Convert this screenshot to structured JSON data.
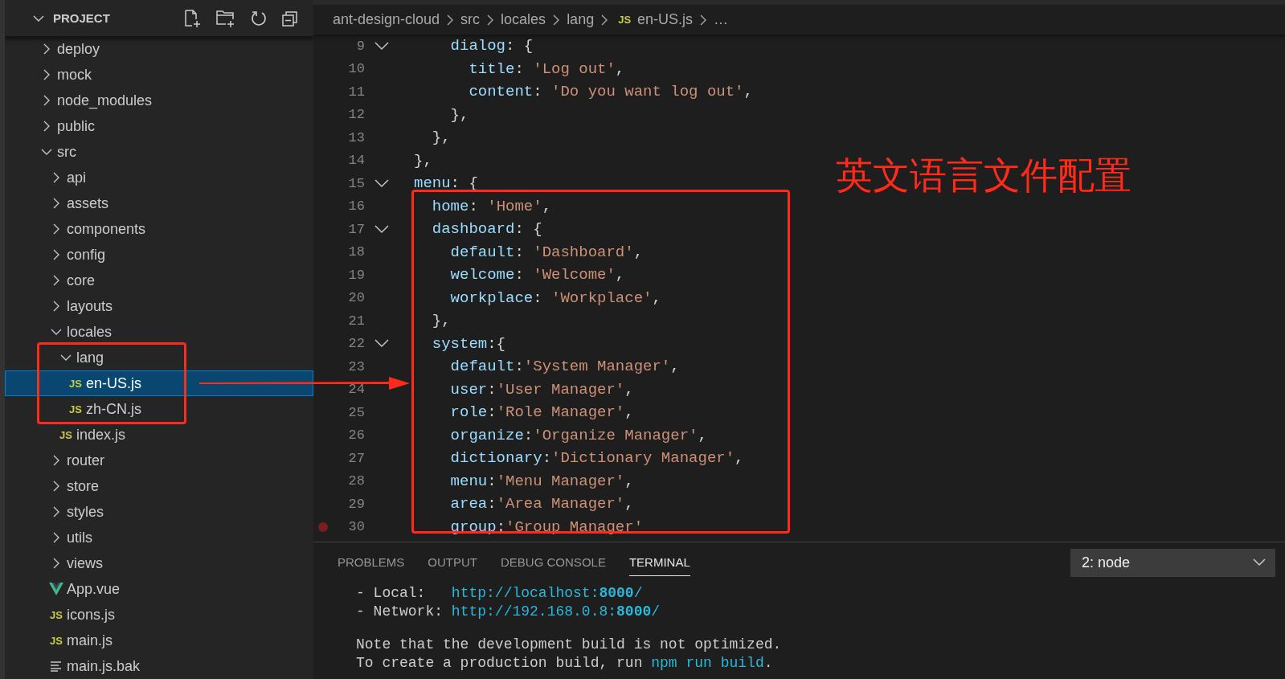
{
  "sidebar": {
    "title": "PROJECT",
    "expanded": true,
    "tree": [
      {
        "name": "deploy",
        "kind": "folder",
        "expanded": false,
        "selected": false
      },
      {
        "name": "mock",
        "kind": "folder",
        "expanded": false,
        "selected": false
      },
      {
        "name": "node_modules",
        "kind": "folder",
        "expanded": false,
        "selected": false
      },
      {
        "name": "public",
        "kind": "folder",
        "expanded": false,
        "selected": false
      },
      {
        "name": "src",
        "kind": "folder",
        "expanded": true,
        "selected": false,
        "children": [
          {
            "name": "api",
            "kind": "folder",
            "expanded": false,
            "selected": false
          },
          {
            "name": "assets",
            "kind": "folder",
            "expanded": false,
            "selected": false
          },
          {
            "name": "components",
            "kind": "folder",
            "expanded": false,
            "selected": false
          },
          {
            "name": "config",
            "kind": "folder",
            "expanded": false,
            "selected": false
          },
          {
            "name": "core",
            "kind": "folder",
            "expanded": false,
            "selected": false
          },
          {
            "name": "layouts",
            "kind": "folder",
            "expanded": false,
            "selected": false
          },
          {
            "name": "locales",
            "kind": "folder",
            "expanded": true,
            "selected": false,
            "children": [
              {
                "name": "lang",
                "kind": "folder",
                "expanded": true,
                "selected": false,
                "children": [
                  {
                    "name": "en-US.js",
                    "kind": "js",
                    "badge": "JS",
                    "selected": true
                  },
                  {
                    "name": "zh-CN.js",
                    "kind": "js",
                    "badge": "JS",
                    "selected": false
                  }
                ]
              },
              {
                "name": "index.js",
                "kind": "js",
                "badge": "JS",
                "selected": false
              }
            ]
          },
          {
            "name": "router",
            "kind": "folder",
            "expanded": false,
            "selected": false
          },
          {
            "name": "store",
            "kind": "folder",
            "expanded": false,
            "selected": false
          },
          {
            "name": "styles",
            "kind": "folder",
            "expanded": false,
            "selected": false
          },
          {
            "name": "utils",
            "kind": "folder",
            "expanded": false,
            "selected": false
          },
          {
            "name": "views",
            "kind": "folder",
            "expanded": false,
            "selected": false
          },
          {
            "name": "App.vue",
            "kind": "vue",
            "selected": false
          },
          {
            "name": "icons.js",
            "kind": "js",
            "badge": "JS",
            "selected": false
          },
          {
            "name": "main.js",
            "kind": "js",
            "badge": "JS",
            "selected": false
          },
          {
            "name": "main.js.bak",
            "kind": "text",
            "selected": false
          }
        ]
      }
    ]
  },
  "breadcrumb": [
    {
      "text": "ant-design-cloud"
    },
    {
      "text": "src"
    },
    {
      "text": "locales"
    },
    {
      "text": "lang"
    },
    {
      "text": "en-US.js",
      "badge": "JS"
    },
    {
      "text": "…"
    }
  ],
  "code": [
    {
      "number": "9",
      "fold": true,
      "tokens": [
        {
          "kind": "key",
          "text": "    dialog"
        },
        {
          "kind": "punct",
          "text": ": {"
        }
      ]
    },
    {
      "number": "10",
      "tokens": [
        {
          "kind": "key",
          "text": "      title"
        },
        {
          "kind": "punct",
          "text": ": "
        },
        {
          "kind": "string",
          "text": "'Log out'"
        },
        {
          "kind": "punct",
          "text": ","
        }
      ]
    },
    {
      "number": "11",
      "tokens": [
        {
          "kind": "key",
          "text": "      content"
        },
        {
          "kind": "punct",
          "text": ": "
        },
        {
          "kind": "string",
          "text": "'Do you want log out'"
        },
        {
          "kind": "punct",
          "text": ","
        }
      ]
    },
    {
      "number": "12",
      "tokens": [
        {
          "kind": "punct",
          "text": "    },"
        }
      ]
    },
    {
      "number": "13",
      "tokens": [
        {
          "kind": "punct",
          "text": "  },"
        }
      ]
    },
    {
      "number": "14",
      "tokens": [
        {
          "kind": "punct",
          "text": "},"
        }
      ]
    },
    {
      "number": "15",
      "fold": true,
      "tokens": [
        {
          "kind": "key",
          "text": "menu"
        },
        {
          "kind": "punct",
          "text": ": {"
        }
      ]
    },
    {
      "number": "16",
      "tokens": [
        {
          "kind": "key",
          "text": "  home"
        },
        {
          "kind": "punct",
          "text": ": "
        },
        {
          "kind": "string",
          "text": "'Home'"
        },
        {
          "kind": "punct",
          "text": ","
        }
      ]
    },
    {
      "number": "17",
      "fold": true,
      "tokens": [
        {
          "kind": "key",
          "text": "  dashboard"
        },
        {
          "kind": "punct",
          "text": ": {"
        }
      ]
    },
    {
      "number": "18",
      "tokens": [
        {
          "kind": "key",
          "text": "    default"
        },
        {
          "kind": "punct",
          "text": ": "
        },
        {
          "kind": "string",
          "text": "'Dashboard'"
        },
        {
          "kind": "punct",
          "text": ","
        }
      ]
    },
    {
      "number": "19",
      "tokens": [
        {
          "kind": "key",
          "text": "    welcome"
        },
        {
          "kind": "punct",
          "text": ": "
        },
        {
          "kind": "string",
          "text": "'Welcome'"
        },
        {
          "kind": "punct",
          "text": ","
        }
      ]
    },
    {
      "number": "20",
      "tokens": [
        {
          "kind": "key",
          "text": "    workplace"
        },
        {
          "kind": "punct",
          "text": ": "
        },
        {
          "kind": "string",
          "text": "'Workplace'"
        },
        {
          "kind": "punct",
          "text": ","
        }
      ]
    },
    {
      "number": "21",
      "tokens": [
        {
          "kind": "punct",
          "text": "  },"
        }
      ]
    },
    {
      "number": "22",
      "fold": true,
      "tokens": [
        {
          "kind": "key",
          "text": "  system"
        },
        {
          "kind": "punct",
          "text": ":{"
        }
      ]
    },
    {
      "number": "23",
      "tokens": [
        {
          "kind": "key",
          "text": "    default"
        },
        {
          "kind": "punct",
          "text": ":"
        },
        {
          "kind": "string",
          "text": "'System Manager'"
        },
        {
          "kind": "punct",
          "text": ","
        }
      ]
    },
    {
      "number": "24",
      "tokens": [
        {
          "kind": "key",
          "text": "    user"
        },
        {
          "kind": "punct",
          "text": ":"
        },
        {
          "kind": "string",
          "text": "'User Manager'"
        },
        {
          "kind": "punct",
          "text": ","
        }
      ]
    },
    {
      "number": "25",
      "tokens": [
        {
          "kind": "key",
          "text": "    role"
        },
        {
          "kind": "punct",
          "text": ":"
        },
        {
          "kind": "string",
          "text": "'Role Manager'"
        },
        {
          "kind": "punct",
          "text": ","
        }
      ]
    },
    {
      "number": "26",
      "tokens": [
        {
          "kind": "key",
          "text": "    organize"
        },
        {
          "kind": "punct",
          "text": ":"
        },
        {
          "kind": "string",
          "text": "'Organize Manager'"
        },
        {
          "kind": "punct",
          "text": ","
        }
      ]
    },
    {
      "number": "27",
      "tokens": [
        {
          "kind": "key",
          "text": "    dictionary"
        },
        {
          "kind": "punct",
          "text": ":"
        },
        {
          "kind": "string",
          "text": "'Dictionary Manager'"
        },
        {
          "kind": "punct",
          "text": ","
        }
      ]
    },
    {
      "number": "28",
      "tokens": [
        {
          "kind": "key",
          "text": "    menu"
        },
        {
          "kind": "punct",
          "text": ":"
        },
        {
          "kind": "string",
          "text": "'Menu Manager'"
        },
        {
          "kind": "punct",
          "text": ","
        }
      ]
    },
    {
      "number": "29",
      "tokens": [
        {
          "kind": "key",
          "text": "    area"
        },
        {
          "kind": "punct",
          "text": ":"
        },
        {
          "kind": "string",
          "text": "'Area Manager'"
        },
        {
          "kind": "punct",
          "text": ","
        }
      ]
    },
    {
      "number": "30",
      "breakpoint": true,
      "tokens": [
        {
          "kind": "key",
          "text": "    group"
        },
        {
          "kind": "punct",
          "text": ":"
        },
        {
          "kind": "string",
          "text": "'Group Manager'"
        }
      ]
    }
  ],
  "annotation": {
    "note": "英文语言文件配置"
  },
  "panel": {
    "tabs": [
      {
        "label": "PROBLEMS",
        "selected": false
      },
      {
        "label": "OUTPUT",
        "selected": false
      },
      {
        "label": "DEBUG CONSOLE",
        "selected": false
      },
      {
        "label": "TERMINAL",
        "selected": true
      }
    ],
    "terminal_select": "2: node",
    "terminal": [
      {
        "parts": [
          {
            "kind": "text",
            "text": "- Local:   "
          },
          {
            "kind": "link",
            "text": "http://localhost:**8000**/"
          }
        ]
      },
      {
        "parts": [
          {
            "kind": "text",
            "text": "- Network: "
          },
          {
            "kind": "link",
            "text": "http://192.168.0.8:**8000**/"
          }
        ]
      },
      {
        "blank_before": true,
        "parts": [
          {
            "kind": "text",
            "text": "Note that the development build is not optimized."
          }
        ]
      },
      {
        "parts": [
          {
            "kind": "text",
            "text": "To create a production build, run "
          },
          {
            "kind": "link",
            "text": "npm run build"
          },
          {
            "kind": "text",
            "text": "."
          }
        ]
      }
    ]
  }
}
